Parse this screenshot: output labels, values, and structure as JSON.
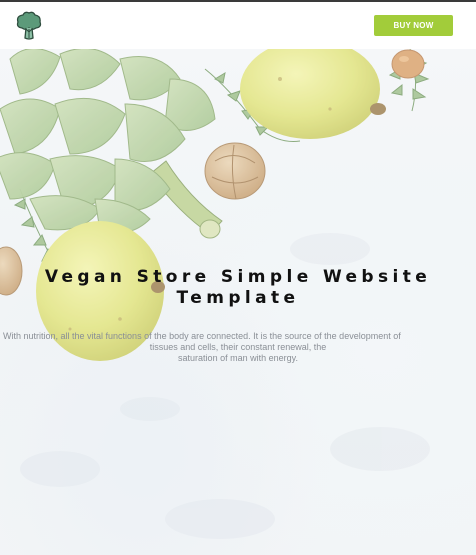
{
  "header": {
    "logo_icon": "broccoli-logo-icon",
    "buy_button_label": "BUY NOW",
    "accent_color": "#a2cc3a"
  },
  "hero": {
    "title": "Vegan Store Simple Website Template",
    "description_line1": "With nutrition, all the vital functions of the body are connected. It is the source of the development of",
    "description_rest": "tissues and cells, their constant renewal, the\nsaturation of man with energy."
  }
}
